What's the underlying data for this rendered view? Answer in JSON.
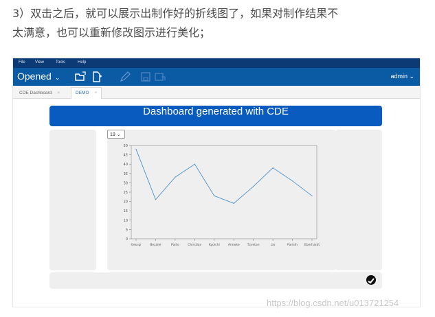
{
  "article": {
    "line1": "3）双击之后，就可以展示出制作好的折线图了，如果对制作结果不",
    "line2": "太满意，也可以重新修改图示进行美化；"
  },
  "menubar": {
    "items": [
      "File",
      "View",
      "Tools",
      "Help"
    ]
  },
  "toolbar": {
    "opened_label": "Opened",
    "opened_chevron": "⌄",
    "admin_label": "admin ⌄",
    "icons": [
      "open-folder-icon",
      "new-file-icon",
      "edit-pencil-icon",
      "save-icon",
      "save-as-icon"
    ]
  },
  "tabs": [
    {
      "label": "CDE Dashboard",
      "close": "×",
      "active": false
    },
    {
      "label": "DEMO",
      "close": "×",
      "active": true
    }
  ],
  "dashboard": {
    "title": "Dashboard generated with CDE",
    "selector_value": "19 ⌄"
  },
  "chart_data": {
    "type": "line",
    "categories": [
      "Georgi",
      "Bezalel",
      "Parto",
      "Chirstian",
      "Kyoichi",
      "Anneke",
      "Tzvetan",
      "Lio",
      "Parisih",
      "Eberhardt"
    ],
    "values": [
      48,
      21,
      33,
      40,
      23,
      19,
      28,
      38,
      31,
      23
    ],
    "ylim": [
      0,
      50
    ],
    "yticks": [
      0,
      5,
      10,
      15,
      20,
      25,
      30,
      35,
      40,
      45,
      50
    ],
    "grid": false,
    "series_color": "#4a90c9"
  },
  "watermark": "https://blog.csdn.net/u013721254"
}
